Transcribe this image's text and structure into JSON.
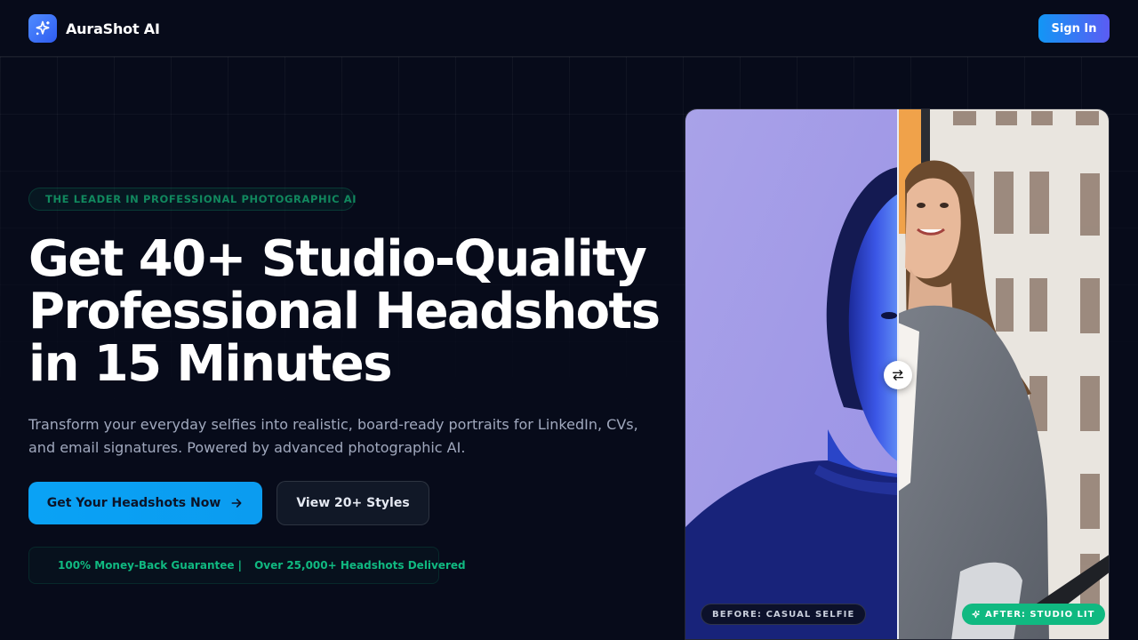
{
  "brand": {
    "name": "AuraShot AI",
    "logo_icon": "sparkles-icon"
  },
  "nav": {
    "signin_label": "Sign In"
  },
  "hero": {
    "eyebrow": "THE LEADER IN PROFESSIONAL PHOTOGRAPHIC AI",
    "eyebrow_icon": "sparkles-icon",
    "title_lines": [
      "Get 40+ Studio-Quality",
      "Professional Headshots",
      "in 15 Minutes"
    ],
    "subtitle": "Transform your everyday selfies into realistic, board-ready portraits for LinkedIn, CVs, and email signatures. Powered by advanced photographic AI.",
    "cta_primary": "Get Your Headshots Now",
    "cta_primary_icon": "arrow-right-icon",
    "cta_secondary": "View 20+ Styles",
    "trust_icon": "check-icon",
    "trust_guarantee": "100% Money-Back Guarantee |",
    "trust_delivered": "Over 25,000+ Headshots Delivered"
  },
  "comparison": {
    "before_label": "BEFORE: CASUAL SELFIE",
    "after_label": "AFTER: STUDIO LIT",
    "after_icon": "sparkles-icon",
    "handle_icon": "swap-arrows-icon"
  },
  "colors": {
    "background": "#070b1a",
    "accent_blue": "#0aa2f5",
    "accent_green": "#10b981",
    "signin_gradient_start": "#1296f5",
    "signin_gradient_end": "#5b5cf3"
  }
}
